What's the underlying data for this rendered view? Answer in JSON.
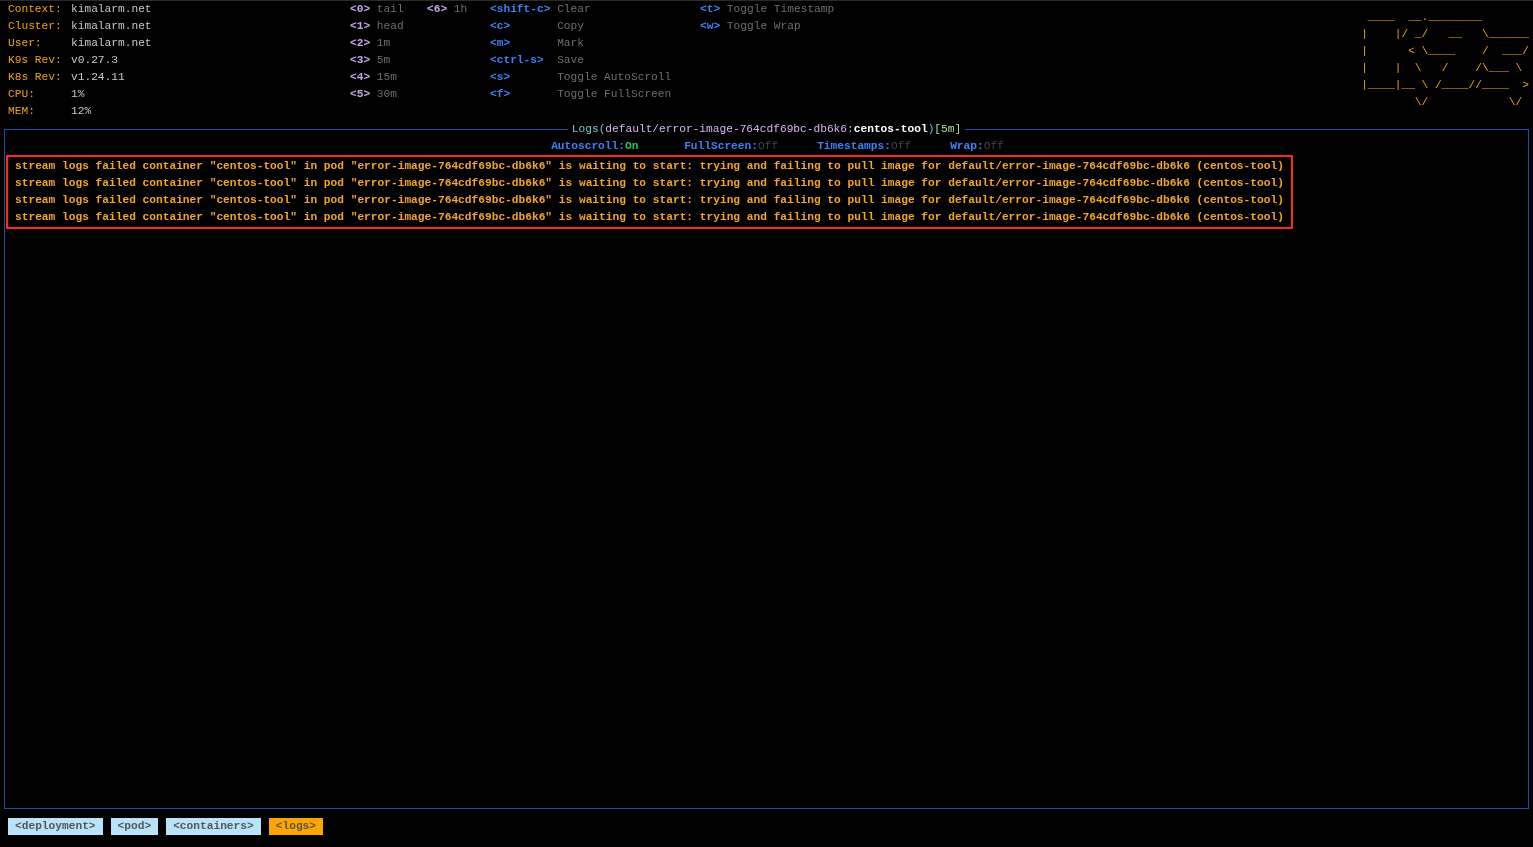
{
  "cluster_info": [
    {
      "label": "Context:",
      "value": "kimalarm.net"
    },
    {
      "label": "Cluster:",
      "value": "kimalarm.net"
    },
    {
      "label": "User:",
      "value": "kimalarm.net"
    },
    {
      "label": "K9s Rev:",
      "value": "v0.27.3"
    },
    {
      "label": "K8s Rev:",
      "value": "v1.24.11"
    },
    {
      "label": "CPU:",
      "value": "1%"
    },
    {
      "label": "MEM:",
      "value": "12%"
    }
  ],
  "hotkey_columns": [
    [
      {
        "key": "<0>",
        "action": "tail",
        "kind": "numeric"
      },
      {
        "key": "<1>",
        "action": "head",
        "kind": "numeric"
      },
      {
        "key": "<2>",
        "action": "1m",
        "kind": "numeric"
      },
      {
        "key": "<3>",
        "action": "5m",
        "kind": "numeric"
      },
      {
        "key": "<4>",
        "action": "15m",
        "kind": "numeric"
      },
      {
        "key": "<5>",
        "action": "30m",
        "kind": "numeric"
      }
    ],
    [
      {
        "key": "<6>",
        "action": "1h",
        "kind": "numeric"
      }
    ],
    [
      {
        "key": "<shift-c>",
        "action": "Clear",
        "kind": "command"
      },
      {
        "key": "<c>",
        "action": "Copy",
        "kind": "command"
      },
      {
        "key": "<m>",
        "action": "Mark",
        "kind": "command"
      },
      {
        "key": "<ctrl-s>",
        "action": "Save",
        "kind": "command"
      },
      {
        "key": "<s>",
        "action": "Toggle AutoScroll",
        "kind": "command"
      },
      {
        "key": "<f>",
        "action": "Toggle FullScreen",
        "kind": "command"
      }
    ],
    [
      {
        "key": "<t>",
        "action": "Toggle Timestamp",
        "kind": "command"
      },
      {
        "key": "<w>",
        "action": "Toggle Wrap",
        "kind": "command"
      }
    ]
  ],
  "logo_lines": [
    " ____  __.________       ",
    "|    |/ _/   __   \\______",
    "|      < \\____    /  ___/",
    "|    |  \\   /    /\\___ \\ ",
    "|____|__ \\ /____//____  >",
    "        \\/            \\/ "
  ],
  "panel": {
    "title": [
      {
        "text": "Logs(",
        "kind": "label"
      },
      {
        "text": "default/error-image-764cdf69bc-db6k6:",
        "kind": "path"
      },
      {
        "text": "centos-tool",
        "kind": "container"
      },
      {
        "text": ")",
        "kind": "label"
      },
      {
        "text": "[5m]",
        "kind": "range"
      }
    ],
    "toggles": [
      {
        "label": "Autoscroll:",
        "value": "On",
        "on": true
      },
      {
        "label": "FullScreen:",
        "value": "Off",
        "on": false
      },
      {
        "label": "Timestamps:",
        "value": "Off",
        "on": false
      },
      {
        "label": "Wrap:",
        "value": "Off",
        "on": false
      }
    ],
    "highlighted": true,
    "log_lines": [
      "stream logs failed container \"centos-tool\" in pod \"error-image-764cdf69bc-db6k6\" is waiting to start: trying and failing to pull image for default/error-image-764cdf69bc-db6k6 (centos-tool)",
      "stream logs failed container \"centos-tool\" in pod \"error-image-764cdf69bc-db6k6\" is waiting to start: trying and failing to pull image for default/error-image-764cdf69bc-db6k6 (centos-tool)",
      "stream logs failed container \"centos-tool\" in pod \"error-image-764cdf69bc-db6k6\" is waiting to start: trying and failing to pull image for default/error-image-764cdf69bc-db6k6 (centos-tool)",
      "stream logs failed container \"centos-tool\" in pod \"error-image-764cdf69bc-db6k6\" is waiting to start: trying and failing to pull image for default/error-image-764cdf69bc-db6k6 (centos-tool)"
    ]
  },
  "breadcrumbs": [
    {
      "label": "<deployment>",
      "selected": false
    },
    {
      "label": "<pod>",
      "selected": false
    },
    {
      "label": "<containers>",
      "selected": false
    },
    {
      "label": "<logs>",
      "selected": true
    }
  ]
}
